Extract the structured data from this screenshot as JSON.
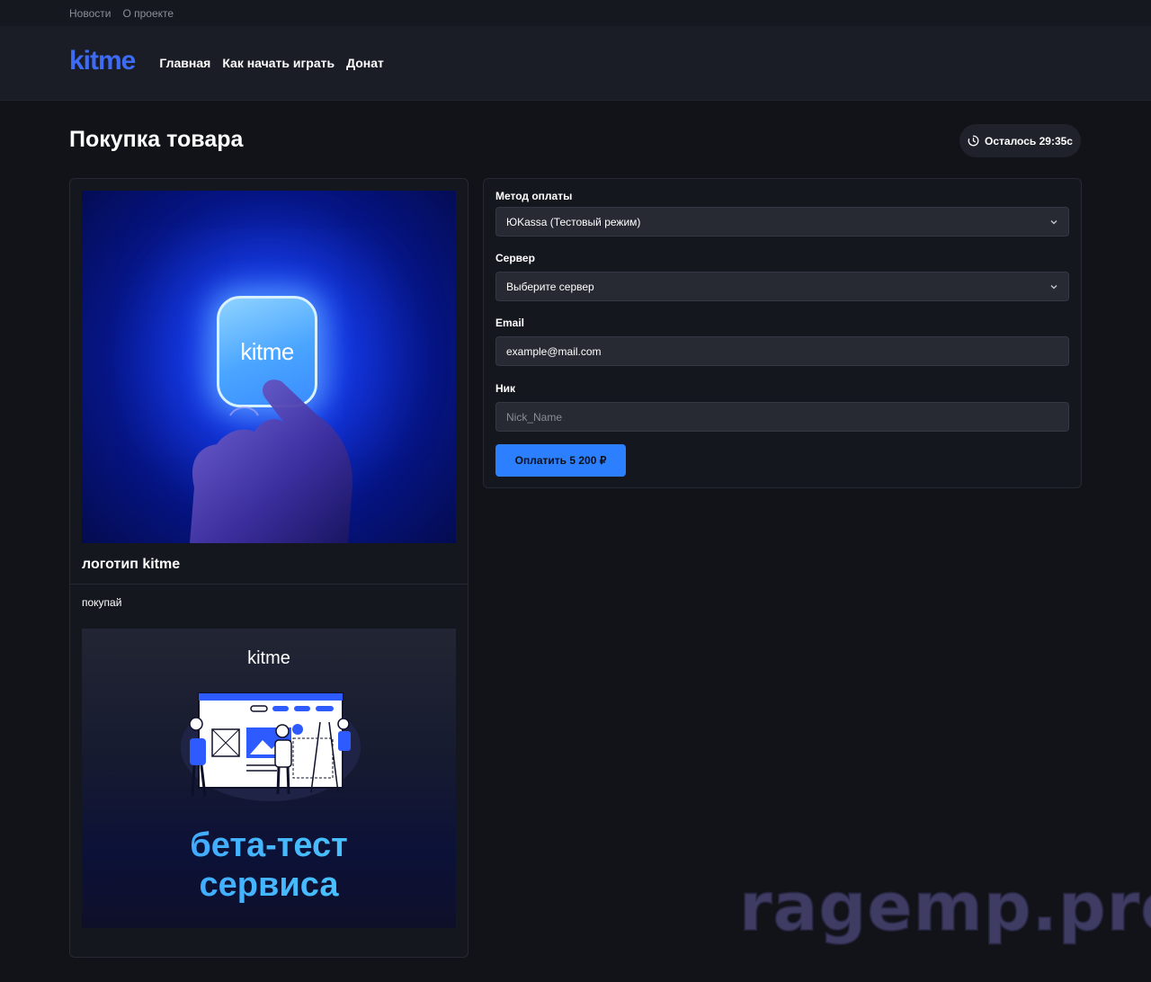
{
  "topbar": {
    "links": [
      "Новости",
      "О проекте"
    ]
  },
  "header": {
    "logo": "kitme",
    "nav": [
      "Главная",
      "Как начать играть",
      "Донат"
    ]
  },
  "page": {
    "title": "Покупка товара",
    "timer": "Осталось 29:35с"
  },
  "product": {
    "image_logo_text": "kitme",
    "name": "логотип kitme",
    "description": "покупай",
    "banner": {
      "logo": "kitme",
      "line1": "бета-тест",
      "line2": "сервиса"
    }
  },
  "form": {
    "payment_method": {
      "label": "Метод оплаты",
      "value": "ЮKassa (Тестовый режим)"
    },
    "server": {
      "label": "Сервер",
      "value": "Выберите сервер"
    },
    "email": {
      "label": "Email",
      "value": "example@mail.com"
    },
    "nick": {
      "label": "Ник",
      "placeholder": "Nick_Name"
    },
    "pay_button": "Оплатить 5 200 ₽"
  },
  "watermark": "ragemp.pro",
  "colors": {
    "accent": "#2c7fff",
    "logo": "#3e6bf5",
    "background": "#121319"
  }
}
